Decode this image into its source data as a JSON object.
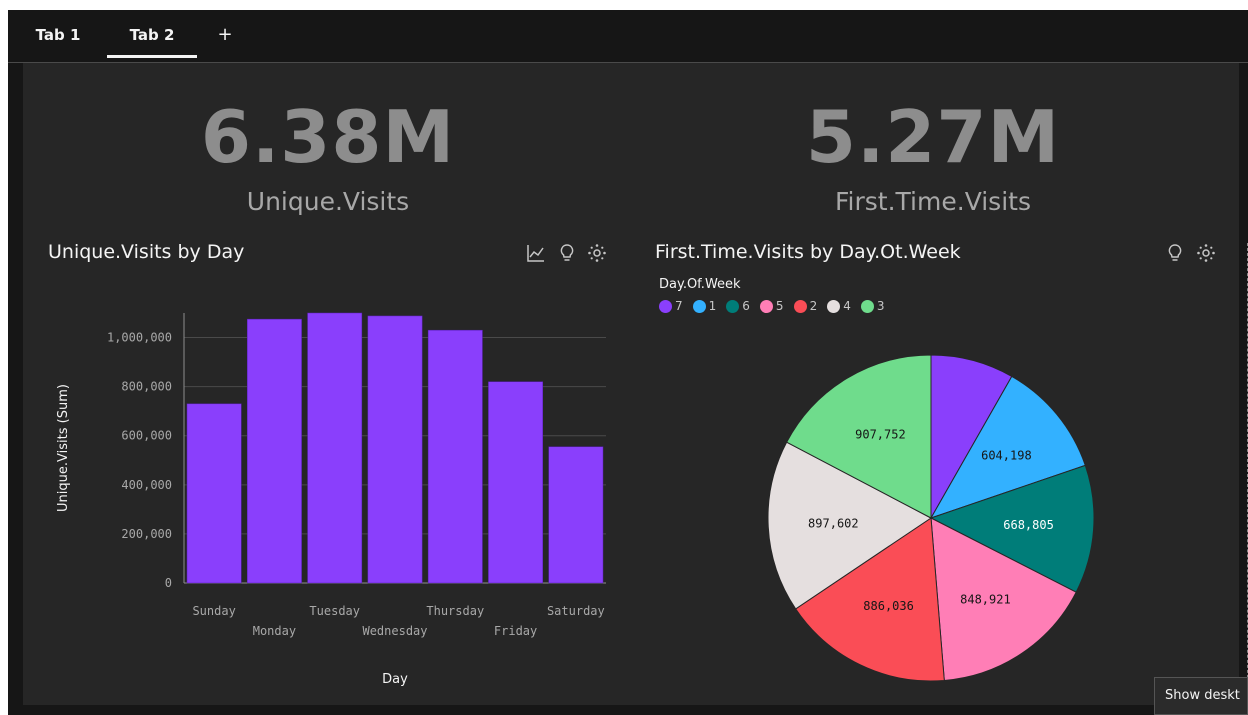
{
  "tabs": [
    {
      "label": "Tab 1",
      "active": false
    },
    {
      "label": "Tab 2",
      "active": true
    }
  ],
  "add_tab_label": "+",
  "kpis": [
    {
      "value": "6.38M",
      "label": "Unique.Visits"
    },
    {
      "value": "5.27M",
      "label": "First.Time.Visits"
    }
  ],
  "bar_widget": {
    "title": "Unique.Visits by Day",
    "icons": [
      "line-chart-icon",
      "lightbulb-icon",
      "settings-icon"
    ]
  },
  "pie_widget": {
    "title": "First.Time.Visits by Day.Ot.Week",
    "legend_title": "Day.Of.Week",
    "icons": [
      "lightbulb-icon",
      "settings-icon"
    ]
  },
  "chart_data": [
    {
      "type": "bar",
      "title": "Unique.Visits by Day",
      "categories": [
        "Sunday",
        "Monday",
        "Tuesday",
        "Wednesday",
        "Thursday",
        "Friday",
        "Saturday"
      ],
      "values": [
        730000,
        1075000,
        1100000,
        1088000,
        1030000,
        820000,
        555000
      ],
      "xlabel": "Day",
      "ylabel": "Unique.Visits (Sum)",
      "ylim": [
        0,
        1100000
      ],
      "yticks": [
        0,
        200000,
        400000,
        600000,
        800000,
        1000000
      ],
      "ytick_labels": [
        "0",
        "200,000",
        "400,000",
        "600,000",
        "800,000",
        "1,000,000"
      ],
      "color": "#8a3ffc",
      "grid": true
    },
    {
      "type": "pie",
      "title": "First.Time.Visits by Day.Ot.Week",
      "legend_title": "Day.Of.Week",
      "legend_position": "top-left",
      "slices": [
        {
          "label": "7",
          "value": 433000,
          "data_label": "",
          "color": "#8a3ffc"
        },
        {
          "label": "1",
          "value": 604198,
          "data_label": "604,198",
          "color": "#33b1ff"
        },
        {
          "label": "6",
          "value": 668805,
          "data_label": "668,805",
          "color": "#007d79"
        },
        {
          "label": "5",
          "value": 848921,
          "data_label": "848,921",
          "color": "#ff7eb6"
        },
        {
          "label": "2",
          "value": 886036,
          "data_label": "886,036",
          "color": "#fa4d56"
        },
        {
          "label": "4",
          "value": 897602,
          "data_label": "897,602",
          "color": "#e5dfdf"
        },
        {
          "label": "3",
          "value": 907752,
          "data_label": "907,752",
          "color": "#6fdc8c"
        }
      ]
    }
  ],
  "tooltip": {
    "text": "Show deskt"
  }
}
